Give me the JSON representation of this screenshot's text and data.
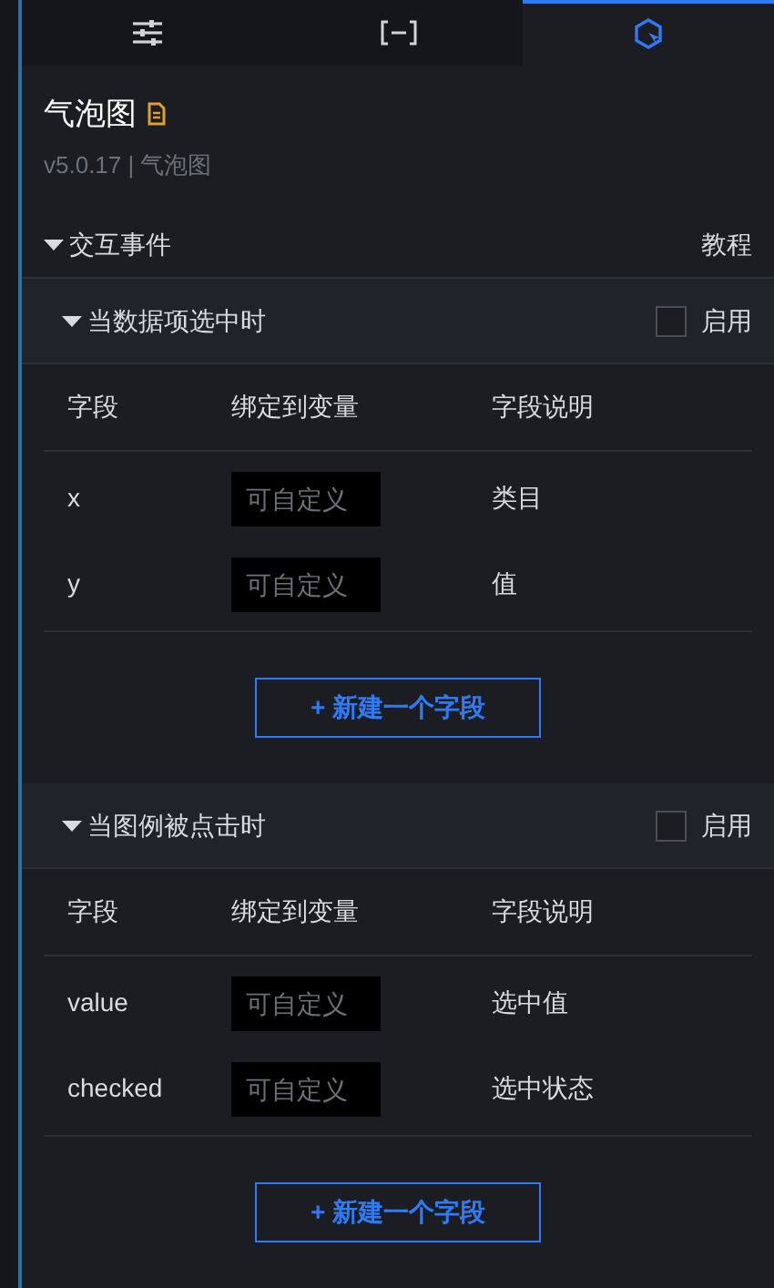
{
  "tabs": [
    {
      "kind": "sliders",
      "selected": false
    },
    {
      "kind": "bracket",
      "selected": false
    },
    {
      "kind": "interaction",
      "selected": true
    }
  ],
  "component": {
    "title": "气泡图",
    "version": "v5.0.17 | 气泡图"
  },
  "section": {
    "title": "交互事件",
    "expanded": true,
    "link": "教程"
  },
  "events": [
    {
      "title": "当数据项选中时",
      "expanded": true,
      "enable_label": "启用",
      "checked": false,
      "columns": [
        "字段",
        "绑定到变量",
        "字段说明"
      ],
      "rows": [
        {
          "field": "x",
          "placeholder": "可自定义",
          "description": "类目"
        },
        {
          "field": "y",
          "placeholder": "可自定义",
          "description": "值"
        }
      ],
      "add_button": "+ 新建一个字段"
    },
    {
      "title": "当图例被点击时",
      "expanded": true,
      "enable_label": "启用",
      "checked": false,
      "columns": [
        "字段",
        "绑定到变量",
        "字段说明"
      ],
      "rows": [
        {
          "field": "value",
          "placeholder": "可自定义",
          "description": "选中值"
        },
        {
          "field": "checked",
          "placeholder": "可自定义",
          "description": "选中状态"
        }
      ],
      "add_button": "+ 新建一个字段"
    }
  ]
}
